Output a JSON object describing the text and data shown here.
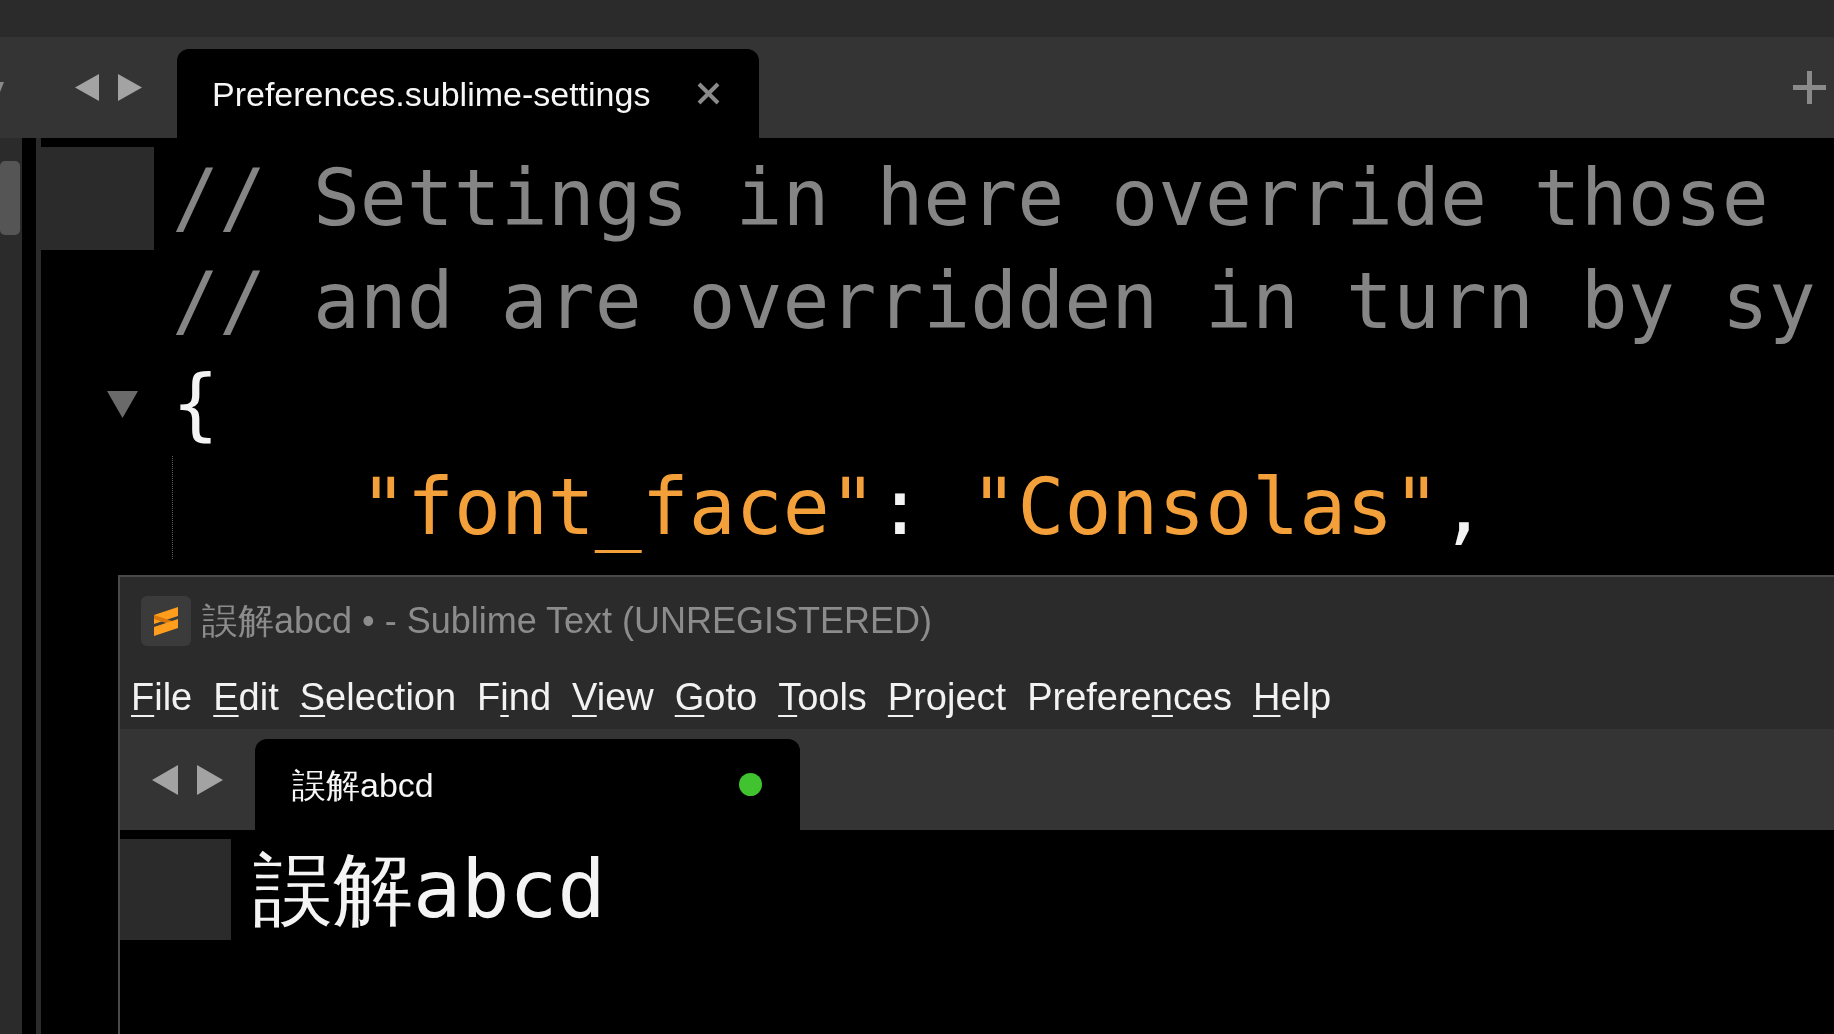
{
  "editor_window": {
    "tabs": [
      {
        "label": "Preferences.sublime-settings",
        "selected": true,
        "modified": false
      }
    ],
    "lines": [
      {
        "current": true,
        "tokens": [
          {
            "kind": "comment",
            "text": "// Settings in here override those"
          }
        ]
      },
      {
        "current": false,
        "tokens": [
          {
            "kind": "comment",
            "text": "// and are overridden in turn by sy"
          }
        ]
      },
      {
        "current": false,
        "expanded": true,
        "tokens": [
          {
            "kind": "punctuation",
            "text": "{"
          }
        ],
        "children": [
          {
            "current": false,
            "tokens": [
              {
                "kind": "string",
                "text": "\"font_face\""
              },
              {
                "kind": "punctuation",
                "text": ": "
              },
              {
                "kind": "string",
                "text": "\"Consolas\""
              },
              {
                "kind": "punctuation",
                "text": ","
              }
            ]
          }
        ]
      }
    ]
  },
  "front_window": {
    "title": "誤解abcd • - Sublime Text (UNREGISTERED)",
    "menu": [
      {
        "accelerator": "F",
        "after": "ile"
      },
      {
        "accelerator": "E",
        "after": "dit"
      },
      {
        "accelerator": "S",
        "after": "election"
      },
      {
        "before": "F",
        "accelerator": "i",
        "after": "nd"
      },
      {
        "accelerator": "V",
        "after": "iew"
      },
      {
        "accelerator": "G",
        "after": "oto"
      },
      {
        "accelerator": "T",
        "after": "ools"
      },
      {
        "accelerator": "P",
        "after": "roject"
      },
      {
        "before": "Prefere",
        "accelerator": "n",
        "after": "ces"
      },
      {
        "accelerator": "H",
        "after": "elp"
      }
    ],
    "tabs": [
      {
        "label": "誤解abcd",
        "selected": true,
        "modified": true
      }
    ],
    "lines": [
      {
        "current": true,
        "tokens": [
          {
            "kind": "plain",
            "text": "誤解abcd"
          }
        ]
      }
    ]
  }
}
